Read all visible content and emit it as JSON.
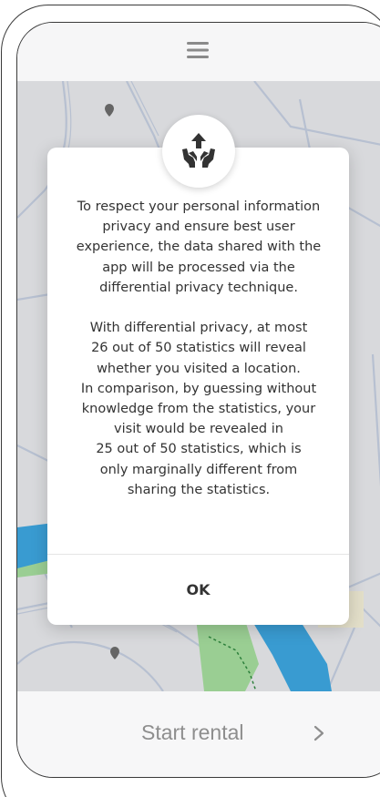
{
  "header": {
    "menu_icon": "hamburger-menu-icon"
  },
  "modal": {
    "icon": "hands-share-arrow-icon",
    "paragraph_1": "To respect your personal information\nprivacy and ensure best user\nexperience, the data shared with the\napp will be processed via the\ndifferential privacy technique.",
    "paragraph_2": "With differential privacy, at most\n26 out of 50 statistics will reveal\nwhether you visited a location.\nIn comparison, by guessing without\nknowledge from the statistics, your\nvisit would be revealed in\n25 out of 50 statistics, which is\nonly marginally different from\nsharing the statistics.",
    "ok_label": "OK"
  },
  "footer": {
    "start_rental_label": "Start rental",
    "chevron_icon": "chevron-right-icon"
  },
  "colors": {
    "river": "#3aa9e6",
    "park": "#a8e3a0",
    "road": "#c9d3e6",
    "accent_text": "#333333",
    "disabled_text": "#8e8e8e"
  }
}
